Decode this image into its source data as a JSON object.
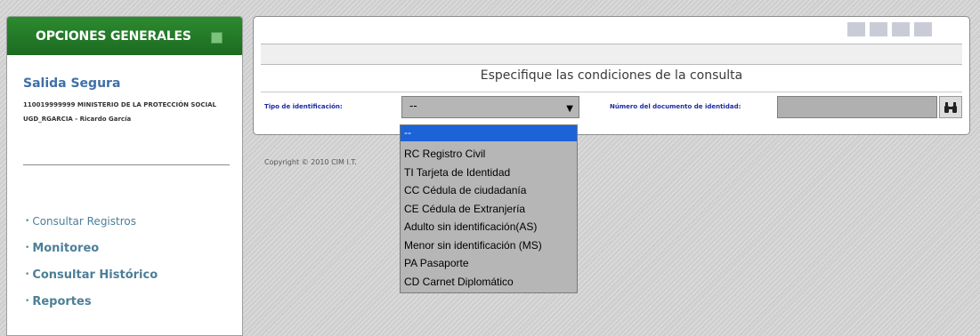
{
  "sidebar": {
    "header": "OPCIONES GENERALES",
    "user": {
      "name": "Salida Segura",
      "org": "110019999999 MINISTERIO DE LA PROTECCIÓN SOCIAL",
      "login": "UGD_RGARCIA - Ricardo García"
    },
    "menu": [
      {
        "label": "Consultar Registros"
      },
      {
        "label": "Monitoreo"
      },
      {
        "label": "Consultar Histórico"
      },
      {
        "label": "Reportes"
      }
    ]
  },
  "main": {
    "query_title": "Especifique las condiciones de la consulta",
    "tipo_label": "Tipo de identificación:",
    "tipo_value": "--",
    "numero_label": "Número del documento de identidad:",
    "numero_value": ""
  },
  "footer": {
    "copyright": "Copyright © 2010 CIM I.T."
  },
  "dropdown": {
    "selected": "--",
    "options": [
      "RC Registro Civil",
      "TI Tarjeta de Identidad",
      "CC Cédula de ciudadanía",
      "CE Cédula de Extranjería",
      "Adulto sin identificación(AS)",
      "Menor sin identificación (MS)",
      "PA Pasaporte",
      "CD Carnet Diplomático"
    ]
  },
  "icons": {
    "search": "binoculars-icon",
    "collapse": "collapse-square-icon",
    "select_arrow": "chevron-down-icon",
    "menu_bullet": "bullet-icon"
  },
  "colors": {
    "header_green": "#1c6b21",
    "label_blue": "#1c2aa6",
    "link_blue": "#4a7f9a",
    "selection_blue": "#1c63d8"
  }
}
